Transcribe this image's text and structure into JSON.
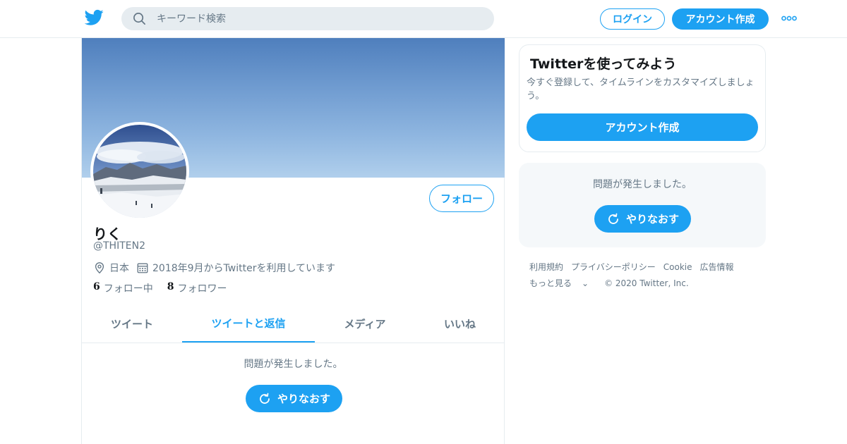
{
  "header": {
    "logo": "twitter-bird-icon",
    "search_placeholder": "キーワード検索",
    "login_label": "ログイン",
    "signup_label": "アカウント作成",
    "more_icon": "more-dots-icon"
  },
  "profile": {
    "display_name": "りく",
    "handle": "@THITEN2",
    "location": "日本",
    "joined": "2018年9月からTwitterを利用しています",
    "follow_label": "フォロー",
    "following_count": "6",
    "following_label": "フォロー中",
    "followers_count": "8",
    "followers_label": "フォロワー"
  },
  "tabs": [
    {
      "label": "ツイート",
      "active": false
    },
    {
      "label": "ツイートと返信",
      "active": true
    },
    {
      "label": "メディア",
      "active": false
    },
    {
      "label": "いいね",
      "active": false
    }
  ],
  "timeline": {
    "error_message": "問題が発生しました。",
    "retry_label": "やりなおす"
  },
  "sidebar": {
    "signup_card": {
      "title": "Twitterを使ってみよう",
      "description": "今すぐ登録して、タイムラインをカスタマイズしましょう。",
      "button_label": "アカウント作成"
    },
    "error_panel": {
      "message": "問題が発生しました。",
      "retry_label": "やりなおす"
    },
    "footer": {
      "links": [
        "利用規約",
        "プライバシーポリシー",
        "Cookie",
        "広告情報"
      ],
      "more_label": "もっと見る",
      "copyright": "© 2020 Twitter, Inc."
    }
  },
  "colors": {
    "accent": "#1da1f2",
    "secondary_text": "#657786",
    "border": "#e6ecf0"
  }
}
